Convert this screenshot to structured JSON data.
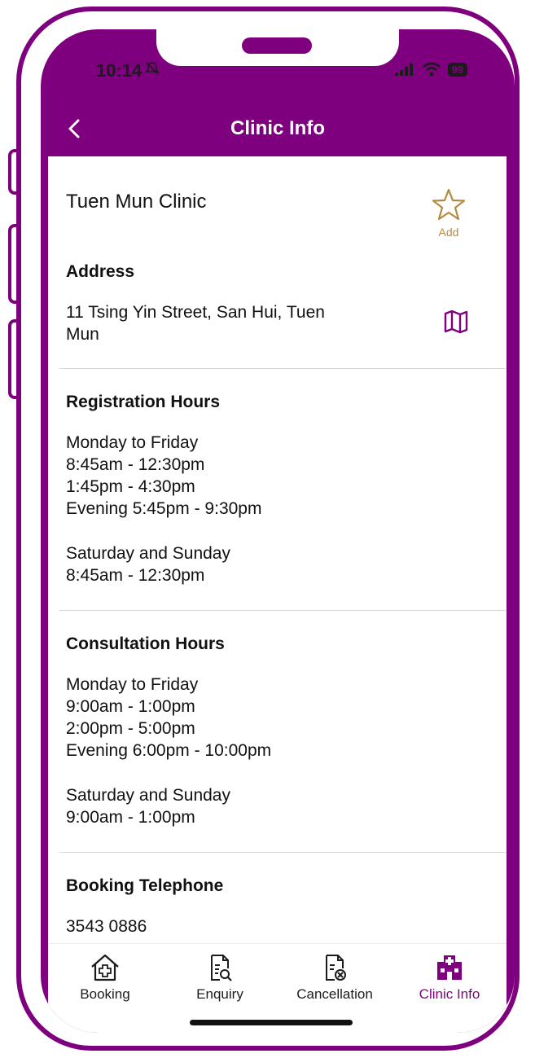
{
  "status_bar": {
    "time": "10:14",
    "battery": "99"
  },
  "header": {
    "title": "Clinic Info"
  },
  "clinic": {
    "name": "Tuen Mun Clinic",
    "favorite_label": "Add",
    "address_title": "Address",
    "address": "11 Tsing Yin Street, San Hui, Tuen\nMun"
  },
  "registration": {
    "title": "Registration Hours",
    "weekday": "Monday to Friday\n8:45am - 12:30pm\n1:45pm - 4:30pm\nEvening 5:45pm - 9:30pm",
    "weekend": "Saturday and Sunday\n8:45am - 12:30pm"
  },
  "consultation": {
    "title": "Consultation Hours",
    "weekday": "Monday to Friday\n9:00am - 1:00pm\n2:00pm - 5:00pm\nEvening 6:00pm - 10:00pm",
    "weekend": "Saturday and Sunday\n9:00am - 1:00pm"
  },
  "booking": {
    "title": "Booking Telephone",
    "phone": "3543 0886"
  },
  "tabs": [
    {
      "label": "Booking",
      "icon": "home-plus-icon"
    },
    {
      "label": "Enquiry",
      "icon": "document-search-icon"
    },
    {
      "label": "Cancellation",
      "icon": "document-cancel-icon"
    },
    {
      "label": "Clinic Info",
      "icon": "hospital-icon",
      "active": true
    }
  ],
  "colors": {
    "brand": "#7f007f",
    "favorite": "#b48a43"
  }
}
